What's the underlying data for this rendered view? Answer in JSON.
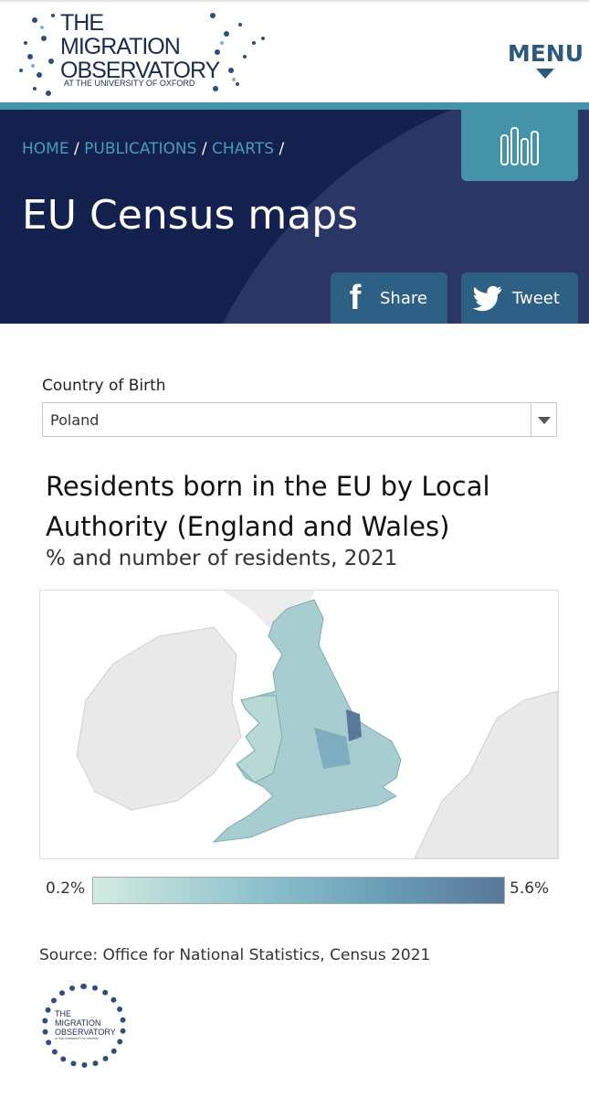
{
  "header": {
    "logo": {
      "line1": "THE",
      "line2": "MIGRATION",
      "line3": "OBSERVATORY",
      "line4": "AT THE UNIVERSITY OF OXFORD"
    },
    "menu_label": "MENU"
  },
  "breadcrumb": [
    {
      "label": "HOME"
    },
    {
      "label": "PUBLICATIONS"
    },
    {
      "label": "CHARTS"
    }
  ],
  "breadcrumb_sep": "/",
  "page_title": "EU Census maps",
  "share": {
    "facebook_label": "Share",
    "twitter_label": "Tweet"
  },
  "filter": {
    "label": "Country of Birth",
    "value": "Poland"
  },
  "chart": {
    "title": "Residents born in the EU by Local Authority (England and Wales)",
    "subtitle": "% and number of residents, 2021"
  },
  "legend": {
    "min": "0.2%",
    "max": "5.6%",
    "colors": [
      "#d4ebe0",
      "#8fc2cd",
      "#6a9fb8",
      "#5a7899"
    ]
  },
  "source": "Source: Office for National Statistics, Census 2021",
  "footer_logo": {
    "line1": "THE",
    "line2": "MIGRATION",
    "line3": "OBSERVATORY",
    "line4": "AT THE UNIVERSITY OF OXFORD"
  }
}
